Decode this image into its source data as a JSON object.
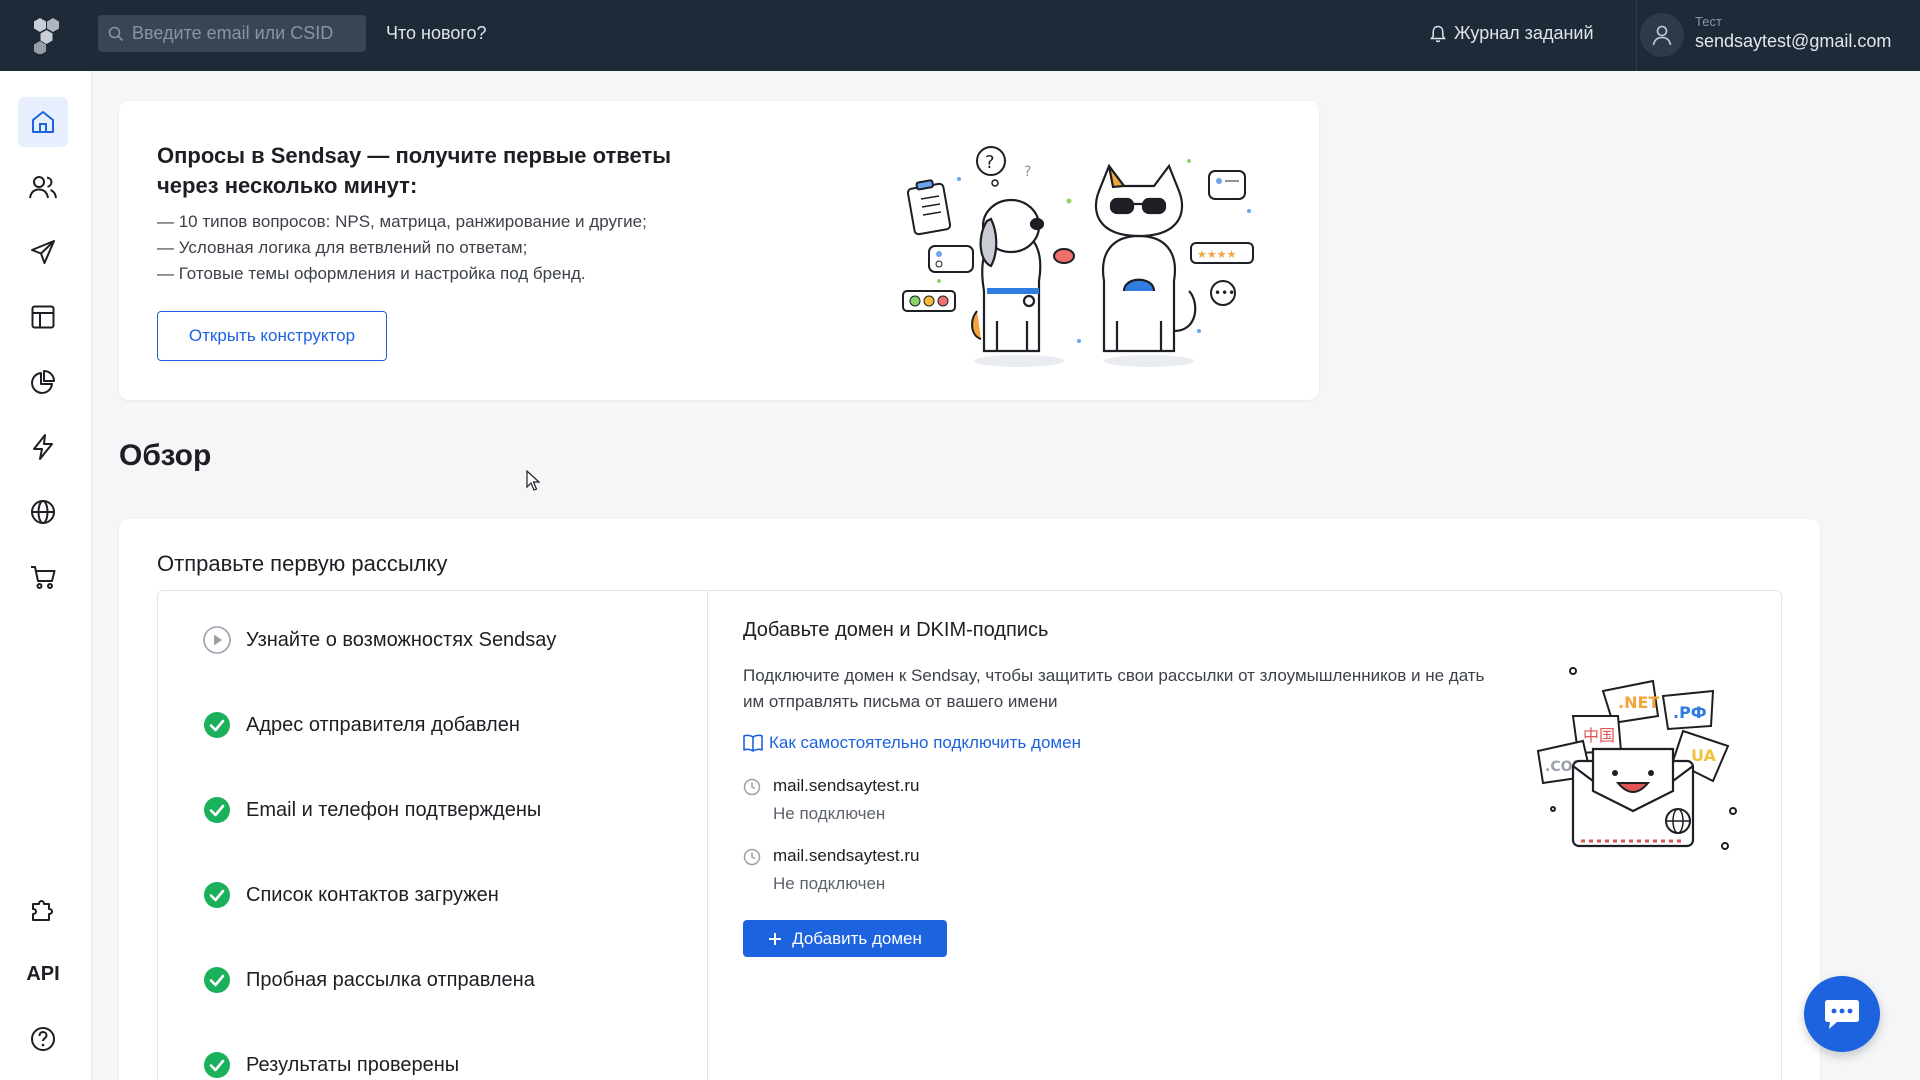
{
  "header": {
    "search_placeholder": "Введите email или CSID",
    "whats_new": "Что нового?",
    "journal": "Журнал заданий",
    "user_role": "Тест",
    "user_email": "sendsaytest@gmail.com"
  },
  "sidebar": {
    "items": [
      {
        "name": "home",
        "icon": "home-icon",
        "active": true
      },
      {
        "name": "contacts",
        "icon": "users-icon"
      },
      {
        "name": "campaigns",
        "icon": "send-icon"
      },
      {
        "name": "templates",
        "icon": "layout-icon"
      },
      {
        "name": "analytics",
        "icon": "pie-chart-icon"
      },
      {
        "name": "automation",
        "icon": "lightning-icon"
      },
      {
        "name": "sites",
        "icon": "globe-icon"
      },
      {
        "name": "ecommerce",
        "icon": "cart-icon"
      }
    ],
    "bottom": {
      "integrations_icon": "puzzle-icon",
      "api_label": "API",
      "help_icon": "help-icon"
    }
  },
  "promo": {
    "title": "Опросы в Sendsay — получите первые ответы через несколько минут:",
    "bullets": [
      "— 10 типов вопросов: NPS, матрица, ранжирование и другие;",
      "— Условная логика для ветвлений по ответам;",
      "— Готовые темы оформления и настройка под бренд."
    ],
    "button": "Открыть конструктор"
  },
  "overview": {
    "title": "Обзор"
  },
  "setup": {
    "title": "Отправьте первую рассылку",
    "steps": [
      {
        "label": "Узнайте о возможностях Sendsay",
        "done": false
      },
      {
        "label": "Адрес отправителя добавлен",
        "done": true
      },
      {
        "label": "Email и телефон подтверждены",
        "done": true
      },
      {
        "label": "Список контактов загружен",
        "done": true
      },
      {
        "label": "Пробная рассылка отправлена",
        "done": true
      },
      {
        "label": "Результаты проверены",
        "done": true
      }
    ],
    "detail": {
      "title": "Добавьте домен и DKIM-подпись",
      "description": "Подключите домен к Sendsay, чтобы защитить свои рассылки от злоумышленников и не дать им отправлять письма от вашего имени",
      "link": "Как самостоятельно подключить домен",
      "domains": [
        {
          "name": "mail.sendsaytest.ru",
          "status": "Не подключен"
        },
        {
          "name": "mail.sendsaytest.ru",
          "status": "Не подключен"
        }
      ],
      "add_button": "Добавить домен",
      "illustration_labels": [
        ".NET",
        ".РФ",
        "中国",
        ".COM",
        "UA"
      ]
    }
  },
  "colors": {
    "topbar": "#1f2a38",
    "accent": "#1d63e0",
    "success": "#1ab05c"
  }
}
